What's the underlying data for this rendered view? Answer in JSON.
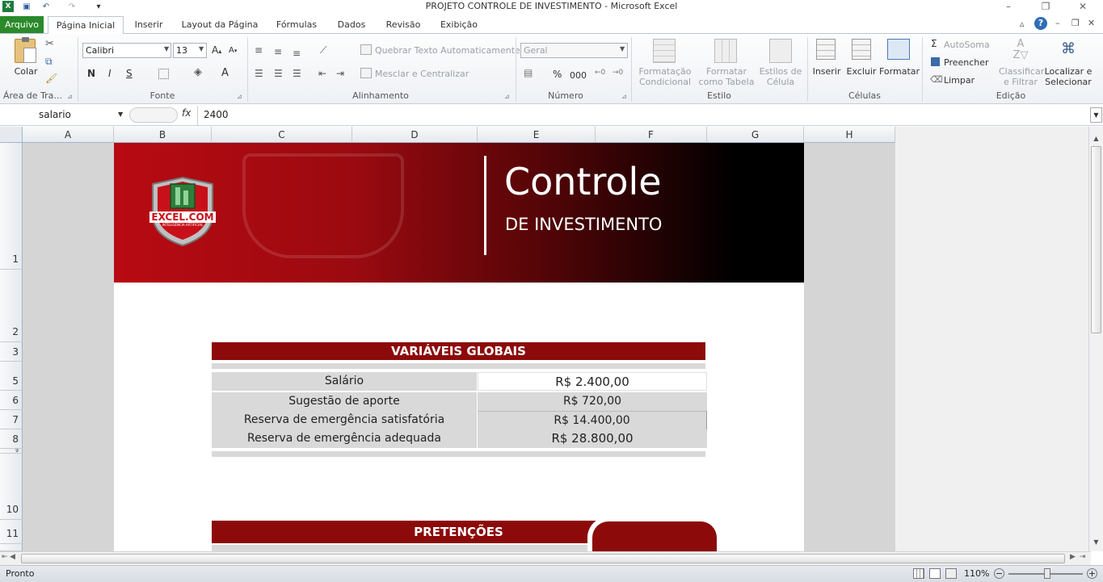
{
  "window": {
    "title": "PROJETO CONTROLE DE INVESTIMENTO  -  Microsoft Excel"
  },
  "tabs": {
    "file": "Arquivo",
    "items": [
      "Página Inicial",
      "Inserir",
      "Layout da Página",
      "Fórmulas",
      "Dados",
      "Revisão",
      "Exibição"
    ]
  },
  "ribbon": {
    "clipboard": {
      "paste": "Colar",
      "group": "Área de Tra..."
    },
    "font": {
      "name": "Calibri",
      "size": "13",
      "bold": "N",
      "italic": "I",
      "underline": "S",
      "group": "Fonte"
    },
    "alignment": {
      "wrap": "Quebrar Texto Automaticamente",
      "merge": "Mesclar e Centralizar",
      "group": "Alinhamento"
    },
    "number": {
      "format": "Geral",
      "percent": "%",
      "thousands": "000",
      "group": "Número"
    },
    "styles": {
      "conditional_1": "Formatação",
      "conditional_2": "Condicional",
      "table_1": "Formatar",
      "table_2": "como Tabela",
      "cell_1": "Estilos de",
      "cell_2": "Célula",
      "group": "Estilo"
    },
    "cells": {
      "insert": "Inserir",
      "delete": "Excluir",
      "format": "Formatar",
      "group": "Células"
    },
    "editing": {
      "autosum": "AutoSoma",
      "fill": "Preencher",
      "clear": "Limpar",
      "sort_1": "Classificar",
      "sort_2": "e Filtrar",
      "find_1": "Localizar e",
      "find_2": "Selecionar",
      "group": "Edição"
    }
  },
  "formula_bar": {
    "name_box": "salario",
    "fx": "fx",
    "value": "2400"
  },
  "columns": [
    "A",
    "B",
    "C",
    "D",
    "E",
    "F",
    "G",
    "H"
  ],
  "rows": [
    "1",
    "2",
    "3",
    "5",
    "6",
    "7",
    "8",
    "9",
    "10",
    "11"
  ],
  "banner": {
    "logo_text": "EXCEL.COM",
    "logo_sub": "INTELIGÊNCIA ARTIFICIAL",
    "title": "Controle",
    "subtitle": "DE INVESTIMENTO"
  },
  "globals": {
    "header": "VARIÁVEIS GLOBAIS",
    "rows": [
      {
        "label": "Salário",
        "value": "R$ 2.400,00"
      },
      {
        "label": "Sugestão de aporte",
        "value": "R$ 720,00"
      },
      {
        "label": "Reserva de emergência satisfatória",
        "value": "R$ 14.400,00"
      },
      {
        "label": "Reserva de emergência adequada",
        "value": "R$ 28.800,00"
      }
    ]
  },
  "pretensions": {
    "header": "PRETENÇÕES"
  },
  "status": {
    "ready": "Pronto",
    "zoom": "110%"
  },
  "colors": {
    "accent": "#8c0a0a",
    "file_tab": "#2a8a2a"
  }
}
